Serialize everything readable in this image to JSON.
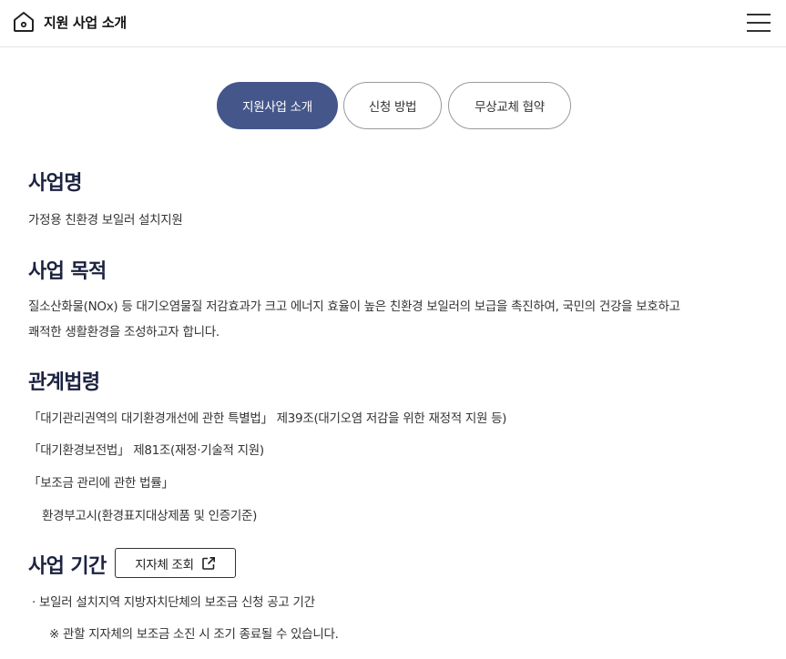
{
  "header": {
    "title": "지원 사업 소개",
    "home_icon": "home-icon",
    "menu_icon": "hamburger-menu-icon"
  },
  "tabs": [
    {
      "label": "지원사업 소개",
      "active": true
    },
    {
      "label": "신청 방법",
      "active": false
    },
    {
      "label": "무상교체 협약",
      "active": false
    }
  ],
  "sections": {
    "name": {
      "heading": "사업명",
      "text": "가정용 친환경 보일러 설치지원"
    },
    "purpose": {
      "heading": "사업 목적",
      "line1": "질소산화물(NOx) 등 대기오염물질 저감효과가 크고 에너지 효율이 높은 친환경 보일러의 보급을 촉진하여, 국민의 건강을 보호하고",
      "line2": "쾌적한 생활환경을 조성하고자 합니다."
    },
    "laws": {
      "heading": "관계법령",
      "items": [
        "「대기관리권역의 대기환경개선에 관한 특별법」 제39조(대기오염 저감을 위한 재정적 지원 등)",
        "「대기환경보전법」 제81조(재정·기술적 지원)",
        "「보조금 관리에 관한 법률」",
        "환경부고시(환경표지대상제품 및 인증기준)"
      ]
    },
    "period": {
      "heading": "사업 기간",
      "button_label": "지자체 조회",
      "button_icon": "external-link-icon",
      "bullet": "· 보일러 설치지역 지방자치단체의 보조금 신청 공고 기간",
      "note": "※ 관할 지자체의 보조금 소진 시 조기 종료될 수 있습니다."
    }
  },
  "colors": {
    "active_tab": "#45568a",
    "heading": "#1c2340"
  }
}
